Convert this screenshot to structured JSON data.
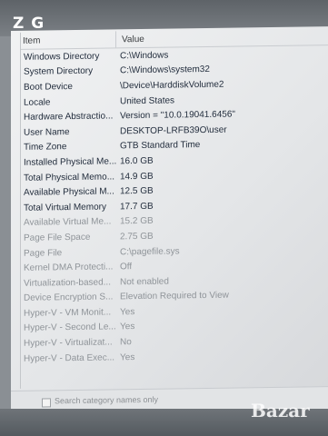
{
  "watermark_top": "Z G",
  "watermark_bottom": "Bazar",
  "columns": {
    "item": "Item",
    "value": "Value"
  },
  "rows": [
    {
      "item": "Windows Directory",
      "value": "C:\\Windows"
    },
    {
      "item": "System Directory",
      "value": "C:\\Windows\\system32"
    },
    {
      "item": "Boot Device",
      "value": "\\Device\\HarddiskVolume2"
    },
    {
      "item": "Locale",
      "value": "United States"
    },
    {
      "item": "Hardware Abstractio...",
      "value": "Version = \"10.0.19041.6456\""
    },
    {
      "item": "User Name",
      "value": "DESKTOP-LRFB39O\\user"
    },
    {
      "item": "Time Zone",
      "value": "GTB Standard Time"
    },
    {
      "item": "Installed Physical Me...",
      "value": "16.0 GB"
    },
    {
      "item": "Total Physical Memo...",
      "value": "14.9 GB"
    },
    {
      "item": "Available Physical M...",
      "value": "12.5 GB"
    },
    {
      "item": "Total Virtual Memory",
      "value": "17.7 GB"
    },
    {
      "item": "Available Virtual Me...",
      "value": "15.2 GB"
    },
    {
      "item": "Page File Space",
      "value": "2.75 GB"
    },
    {
      "item": "Page File",
      "value": "C:\\pagefile.sys"
    },
    {
      "item": "Kernel DMA Protecti...",
      "value": "Off"
    },
    {
      "item": "Virtualization-based...",
      "value": "Not enabled"
    },
    {
      "item": "Device Encryption S...",
      "value": "Elevation Required to View"
    },
    {
      "item": "Hyper-V - VM Monit...",
      "value": "Yes"
    },
    {
      "item": "Hyper-V - Second Le...",
      "value": "Yes"
    },
    {
      "item": "Hyper-V - Virtualizat...",
      "value": "No"
    },
    {
      "item": "Hyper-V - Data Exec...",
      "value": "Yes"
    }
  ],
  "search_category_label": "Search category names only",
  "colors": {
    "row_text_dark": "#1f2a3a",
    "row_text_light": "#8f9499"
  }
}
